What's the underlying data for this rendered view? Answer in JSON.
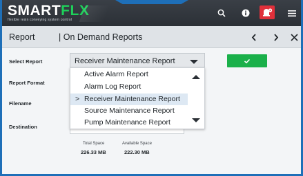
{
  "header": {
    "logo_text_white": "SMART",
    "logo_text_green": "FLX",
    "tagline": "flexible resin conveying system control",
    "colors": {
      "brand_green": "#1ed05a",
      "alarm_red": "#e0303a",
      "frame_blue": "#1e6fb8"
    },
    "icons": [
      "search-icon",
      "info-icon",
      "alarm-icon",
      "menu-icon"
    ]
  },
  "titlebar": {
    "title": "Report",
    "subtitle": "| On Demand Reports"
  },
  "form": {
    "select_report_label": "Select Report",
    "report_format_label": "Report Format",
    "filename_label": "Filename",
    "destination_label": "Destination",
    "selected_report": "Receiver Maintenance Report",
    "submit_icon": "checkmark-icon"
  },
  "dropdown": {
    "items": [
      {
        "label": "Active Alarm Report",
        "selected": false
      },
      {
        "label": "Alarm Log Report",
        "selected": false
      },
      {
        "label": "Receiver Maintenance Report",
        "selected": true
      },
      {
        "label": "Source Maintenance Report",
        "selected": false
      },
      {
        "label": "Pump Maintenance Report",
        "selected": false
      }
    ],
    "selected_marker": ">"
  },
  "storage": {
    "total_label": "Total Space",
    "total_value": "226.33 MB",
    "available_label": "Available Space",
    "available_value": "222.30 MB"
  }
}
